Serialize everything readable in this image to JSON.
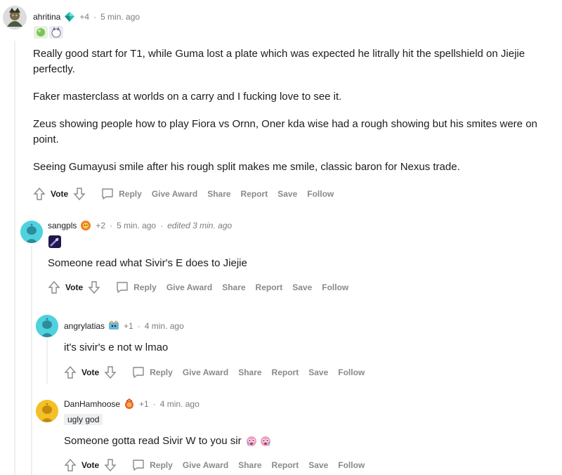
{
  "comments": [
    {
      "username": "ahritina",
      "karma": "+4",
      "time": "5 min. ago",
      "paragraphs": [
        "Really good start for T1, while Guma lost a plate which was expected he litrally hit the spellshield on Jiejie perfectly.",
        "Faker masterclass at worlds on a carry and I fucking love to see it.",
        "Zeus showing people how to play Fiora vs Ornn, Oner kda wise had a rough showing but his smites were on point.",
        "Seeing Gumayusi smile after his rough split makes me smile, classic baron for Nexus trade."
      ]
    },
    {
      "username": "sangpls",
      "karma": "+2",
      "time": "5 min. ago",
      "edited": "edited 3 min. ago",
      "paragraphs": [
        "Someone read what Sivir's E does to Jiejie"
      ]
    },
    {
      "username": "angrylatias",
      "karma": "+1",
      "time": "4 min. ago",
      "paragraphs": [
        "it's sivir's e not w lmao"
      ]
    },
    {
      "username": "DanHamhoose",
      "karma": "+1",
      "time": "4 min. ago",
      "flair_text": "ugly god",
      "paragraphs": [
        "Someone gotta read Sivir W to you sir"
      ]
    }
  ],
  "actions": {
    "vote": "Vote",
    "reply": "Reply",
    "give_award": "Give Award",
    "share": "Share",
    "report": "Report",
    "save": "Save",
    "follow": "Follow"
  },
  "separator": "·",
  "colors": {
    "text": "#1c1c1c",
    "meta": "#7c7c7c",
    "action": "#878a8c",
    "thread_line": "#edeff1",
    "avatar_cyan": "#4fd1e0",
    "avatar_yellow": "#f5c026"
  },
  "icons": [
    "upvote-icon",
    "downvote-icon",
    "reply-icon",
    "diamond-flair-icon",
    "emoji-flair-icon"
  ]
}
